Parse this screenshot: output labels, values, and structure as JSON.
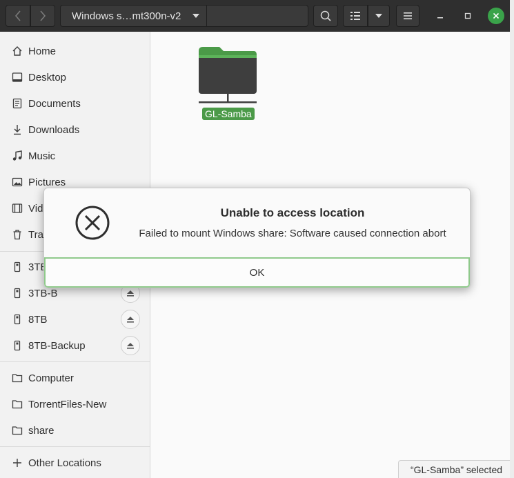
{
  "headerbar": {
    "path_label": "Windows s…mt300n-v2"
  },
  "sidebar": {
    "places": [
      {
        "label": "Home",
        "icon": "home-icon"
      },
      {
        "label": "Desktop",
        "icon": "desktop-icon"
      },
      {
        "label": "Documents",
        "icon": "documents-icon"
      },
      {
        "label": "Downloads",
        "icon": "downloads-icon"
      },
      {
        "label": "Music",
        "icon": "music-icon"
      },
      {
        "label": "Pictures",
        "icon": "pictures-icon"
      },
      {
        "label": "Vid",
        "icon": "videos-icon"
      },
      {
        "label": "Tra",
        "icon": "trash-icon"
      }
    ],
    "devices": [
      {
        "label": "3TE",
        "icon": "usb-drive-icon"
      },
      {
        "label": "3TB-B",
        "icon": "usb-drive-icon"
      },
      {
        "label": "8TB",
        "icon": "usb-drive-icon"
      },
      {
        "label": "8TB-Backup",
        "icon": "usb-drive-icon"
      }
    ],
    "bookmarks": [
      {
        "label": "Computer",
        "icon": "folder-icon"
      },
      {
        "label": "TorrentFiles-New",
        "icon": "folder-icon"
      },
      {
        "label": "share",
        "icon": "folder-icon"
      }
    ],
    "other_locations": {
      "label": "Other Locations",
      "icon": "plus-icon"
    }
  },
  "main": {
    "folder_name": "GL-Samba",
    "status_text": "“GL-Samba” selected"
  },
  "dialog": {
    "title": "Unable to access location",
    "message": "Failed to mount Windows share: Software caused connection abort",
    "ok_label": "OK"
  },
  "colors": {
    "accent": "#4b9a48",
    "headerbar": "#2f2f2f",
    "close_button": "#3aa34a"
  }
}
